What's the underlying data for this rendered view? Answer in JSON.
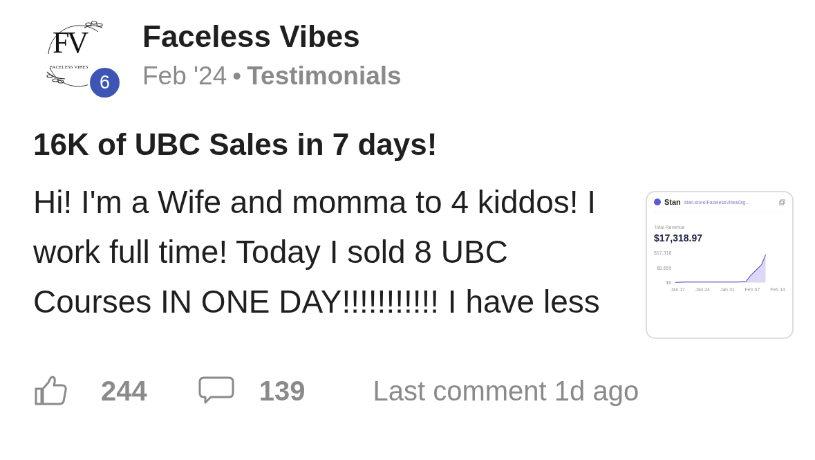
{
  "post": {
    "author": {
      "name": "Faceless Vibes",
      "logo_initials": "FV",
      "logo_name": "FACELESS VIBES",
      "level_badge": "6"
    },
    "date": "Feb '24",
    "separator": "•",
    "category": "Testimonials",
    "title": "16K of UBC Sales in 7 days!",
    "body": "Hi! I'm a Wife and momma to 4 kiddos! I work full time! Today I sold 8 UBC Courses IN ONE DAY!!!!!!!!!!! I have less",
    "thumbnail": {
      "brand": "Stan",
      "url": "stan.store/FacelessVibesDig...",
      "metric_label": "Total Revenue",
      "metric_value": "$17,318.97",
      "y_labels": [
        "$17,318",
        "$8,659",
        "$0"
      ],
      "x_labels": [
        "Jan 17",
        "Jan 24",
        "Jan 31",
        "Feb 07",
        "Feb 14"
      ]
    },
    "likes": "244",
    "comments": "139",
    "last_comment": "Last comment 1d ago"
  }
}
